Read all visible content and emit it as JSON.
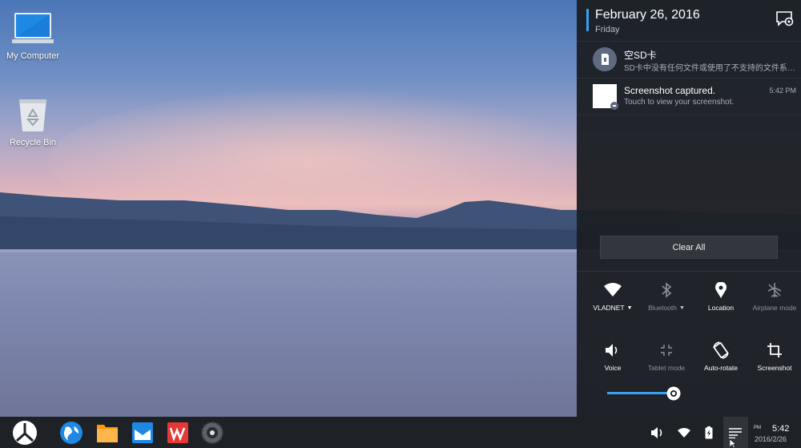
{
  "desktop": {
    "icons": [
      {
        "label": "My Computer",
        "icon": "computer-icon"
      },
      {
        "label": "Recycle Bin",
        "icon": "recycle-bin-icon"
      }
    ]
  },
  "panel": {
    "date": "February 26, 2016",
    "day": "Friday",
    "settings_icon": "notification-settings-icon",
    "accent": "#3aa0f0",
    "notifications": [
      {
        "title": "空SD卡",
        "subtitle": "SD卡中没有任何文件或使用了不支持的文件系…",
        "time": "",
        "icon": "sd-card-icon"
      },
      {
        "title": "Screenshot captured.",
        "subtitle": "Touch to view your screenshot.",
        "time": "5:42 PM",
        "icon": "screenshot-thumbnail-icon"
      }
    ],
    "clear_all": "Clear All",
    "quick_settings": [
      {
        "label": "VLADNET",
        "icon": "wifi-icon",
        "active": true,
        "dropdown": true
      },
      {
        "label": "Bluetooth",
        "icon": "bluetooth-icon",
        "active": false,
        "dropdown": true
      },
      {
        "label": "Location",
        "icon": "location-icon",
        "active": true,
        "dropdown": false
      },
      {
        "label": "Airplane mode",
        "icon": "airplane-icon",
        "active": false,
        "dropdown": false
      },
      {
        "label": "Voice",
        "icon": "volume-icon",
        "active": true,
        "dropdown": false
      },
      {
        "label": "Tablet mode",
        "icon": "tablet-mode-icon",
        "active": false,
        "dropdown": false
      },
      {
        "label": "Auto-rotate",
        "icon": "auto-rotate-icon",
        "active": true,
        "dropdown": false
      },
      {
        "label": "Screenshot",
        "icon": "crop-icon",
        "active": true,
        "dropdown": false
      }
    ],
    "brightness": 0.85
  },
  "taskbar": {
    "apps": [
      "start-menu-icon",
      "browser-icon",
      "file-manager-icon",
      "email-icon",
      "wps-office-icon",
      "settings-icon"
    ],
    "tray": [
      "volume-icon",
      "wifi-icon",
      "battery-icon",
      "notifications-icon"
    ],
    "clock_ampm": "PM",
    "clock_time": "5:42",
    "clock_date": "2016/2/26"
  }
}
